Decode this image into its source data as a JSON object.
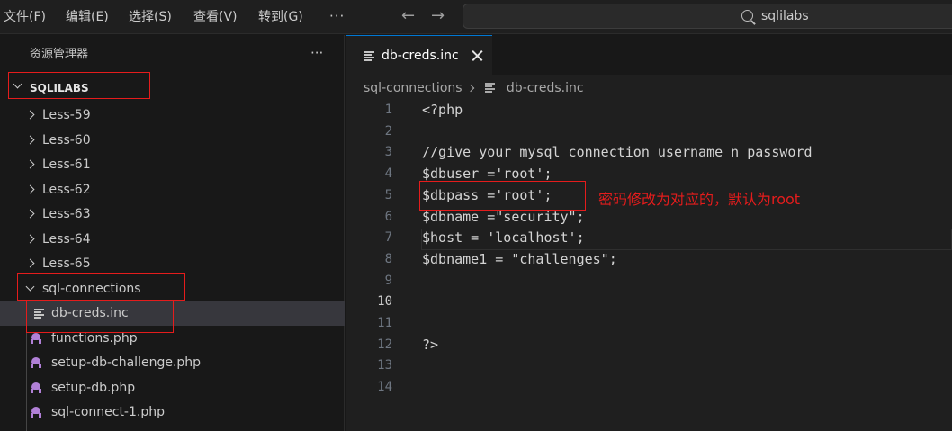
{
  "titlebar": {
    "menus": [
      {
        "label": "文件(F)"
      },
      {
        "label": "编辑(E)"
      },
      {
        "label": "选择(S)"
      },
      {
        "label": "查看(V)"
      },
      {
        "label": "转到(G)"
      }
    ],
    "more": "···",
    "search_text": "sqlilabs"
  },
  "sidebar": {
    "title": "资源管理器",
    "more": "···",
    "root_label": "SQLILABS",
    "folders": [
      {
        "label": "Less-59"
      },
      {
        "label": "Less-60"
      },
      {
        "label": "Less-61"
      },
      {
        "label": "Less-62"
      },
      {
        "label": "Less-63"
      },
      {
        "label": "Less-64"
      },
      {
        "label": "Less-65"
      }
    ],
    "open_folder": "sql-connections",
    "files": [
      {
        "label": "db-creds.inc",
        "icon": "text-file-icon",
        "selected": true
      },
      {
        "label": "functions.php",
        "icon": "php-file-icon"
      },
      {
        "label": "setup-db-challenge.php",
        "icon": "php-file-icon"
      },
      {
        "label": "setup-db.php",
        "icon": "php-file-icon"
      },
      {
        "label": "sql-connect-1.php",
        "icon": "php-file-icon"
      }
    ]
  },
  "editor": {
    "tab_label": "db-creds.inc",
    "breadcrumb": {
      "folder": "sql-connections",
      "file": "db-creds.inc"
    },
    "active_line": 10,
    "lines": [
      {
        "n": "1",
        "text": "<?php"
      },
      {
        "n": "2",
        "text": ""
      },
      {
        "n": "3",
        "text": "//give your mysql connection username n password"
      },
      {
        "n": "4",
        "text": "$dbuser ='root';"
      },
      {
        "n": "5",
        "text": "$dbpass ='root';"
      },
      {
        "n": "6",
        "text": "$dbname =\"security\";"
      },
      {
        "n": "7",
        "text": "$host = 'localhost';"
      },
      {
        "n": "8",
        "text": "$dbname1 = \"challenges\";"
      },
      {
        "n": "9",
        "text": ""
      },
      {
        "n": "10",
        "text": ""
      },
      {
        "n": "11",
        "text": ""
      },
      {
        "n": "12",
        "text": "?>"
      },
      {
        "n": "13",
        "text": ""
      },
      {
        "n": "14",
        "text": ""
      }
    ]
  },
  "annotation": {
    "text": "密码修改为对应的，默认为root",
    "color": "#e51c1c"
  }
}
